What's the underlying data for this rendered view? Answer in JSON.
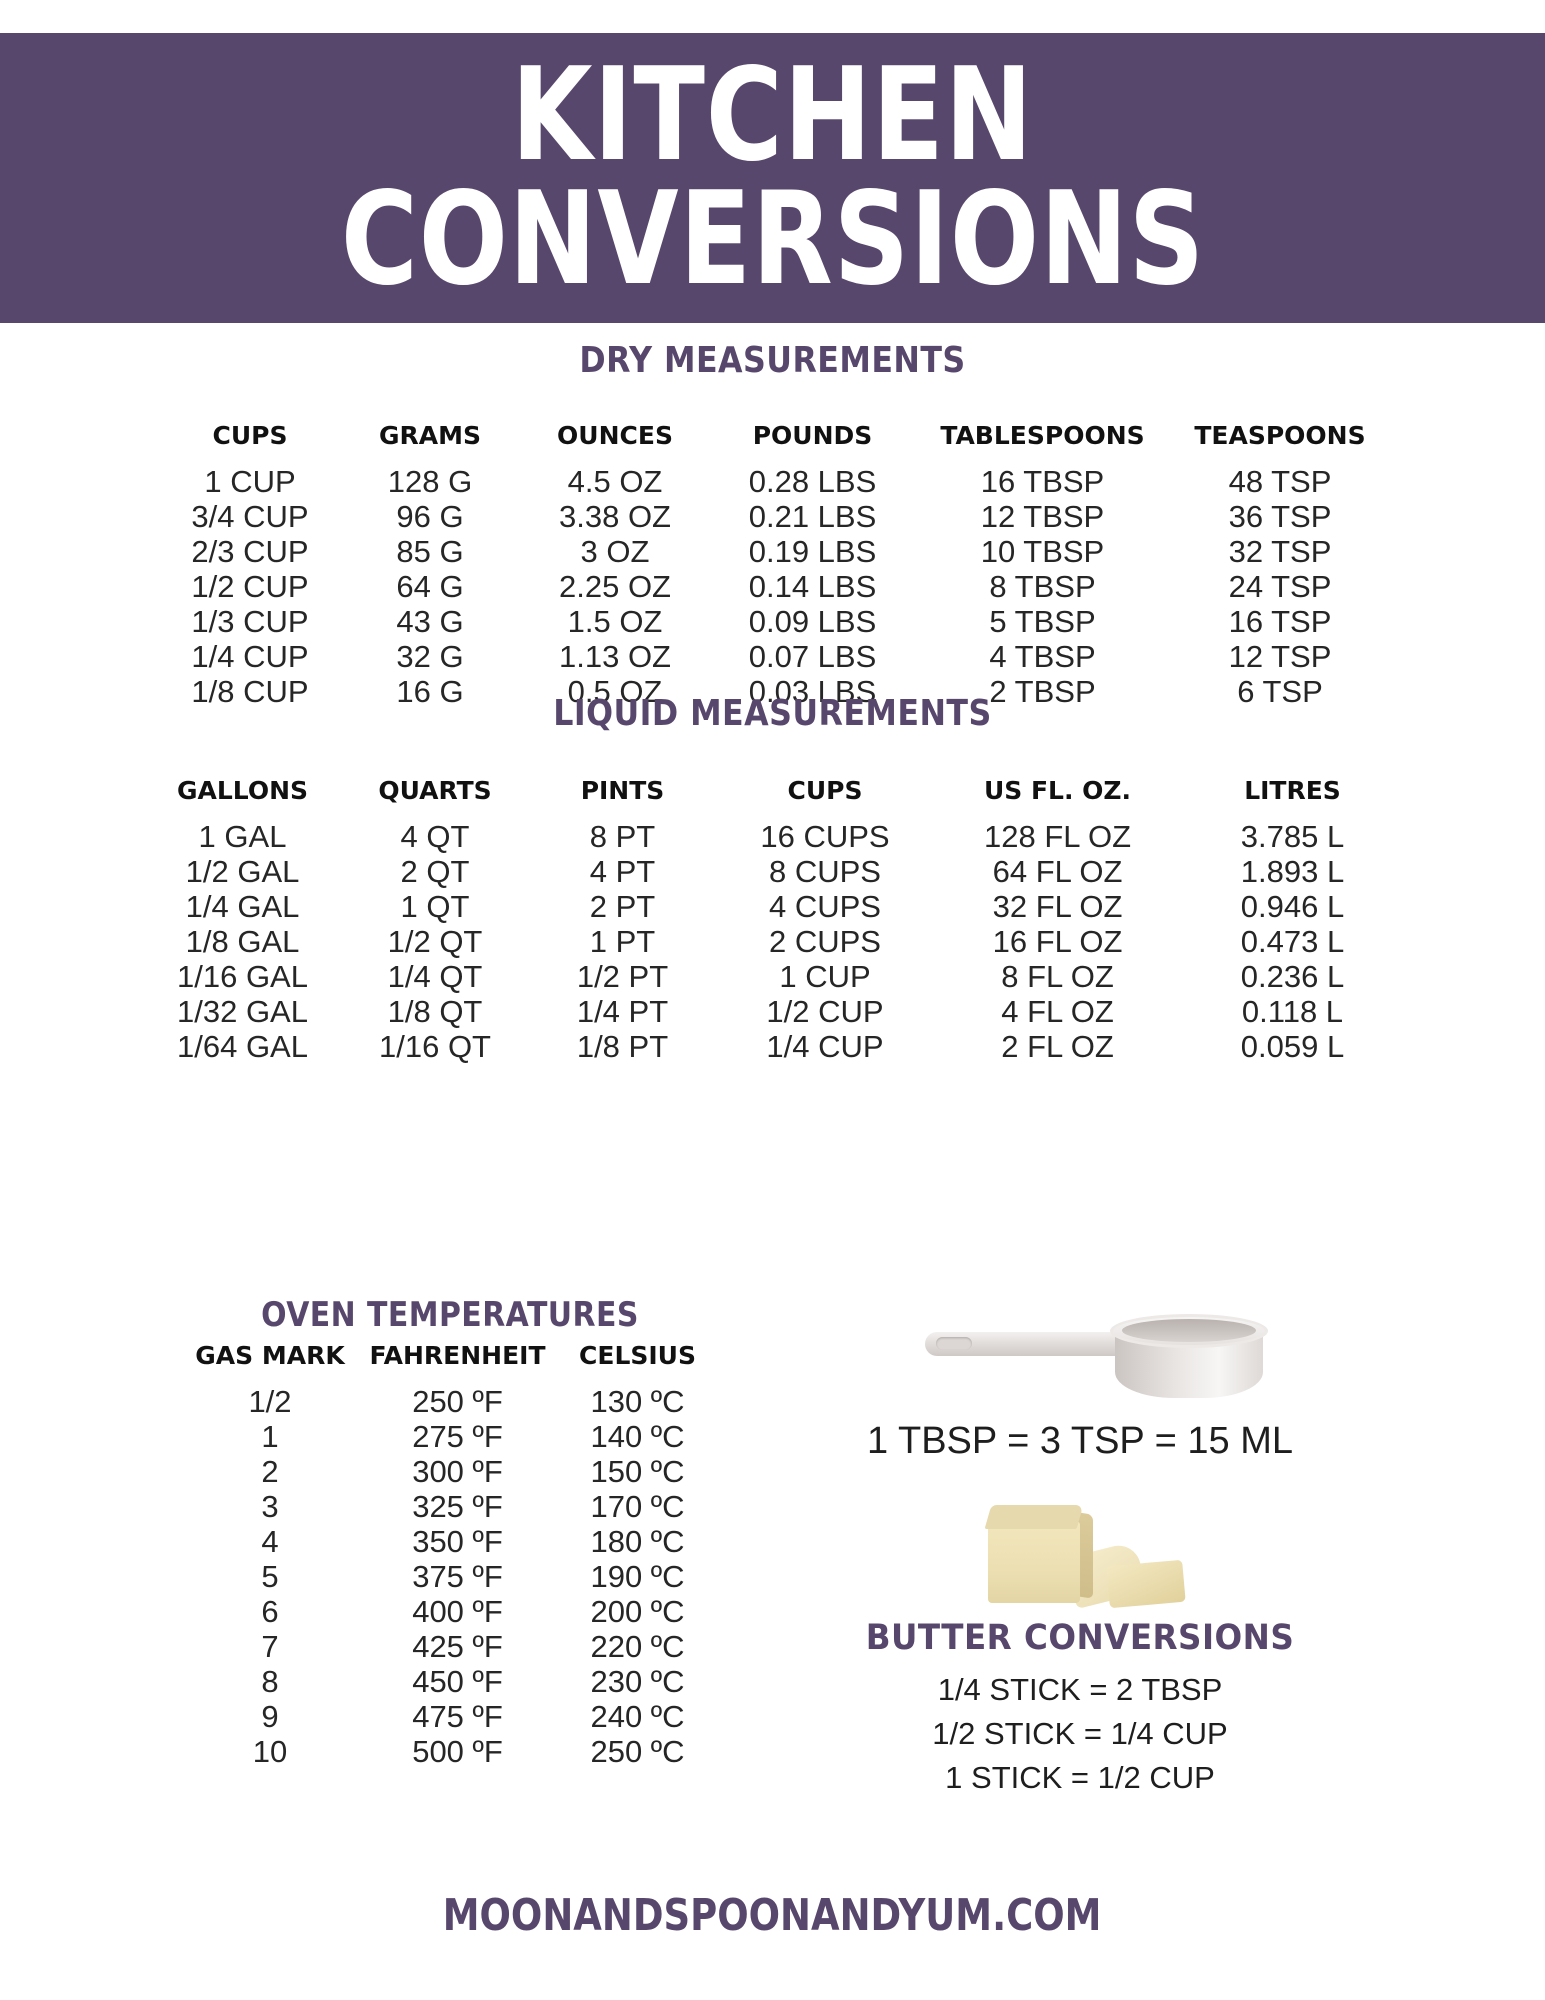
{
  "banner": {
    "line1": "KITCHEN",
    "line2": "CONVERSIONS",
    "background_color": "#58476C",
    "text_color": "#FFFFFF"
  },
  "accent_color": "#58476C",
  "dry": {
    "title": "DRY MEASUREMENTS",
    "columns": [
      "CUPS",
      "GRAMS",
      "OUNCES",
      "POUNDS",
      "TABLESPOONS",
      "TEASPOONS"
    ],
    "rows": [
      [
        "1 CUP",
        "128 G",
        "4.5 OZ",
        "0.28 LBS",
        "16 TBSP",
        "48 TSP"
      ],
      [
        "3/4 CUP",
        "96 G",
        "3.38 OZ",
        "0.21 LBS",
        "12 TBSP",
        "36 TSP"
      ],
      [
        "2/3 CUP",
        "85 G",
        "3 OZ",
        "0.19 LBS",
        "10 TBSP",
        "32 TSP"
      ],
      [
        "1/2 CUP",
        "64 G",
        "2.25 OZ",
        "0.14 LBS",
        "8 TBSP",
        "24 TSP"
      ],
      [
        "1/3 CUP",
        "43 G",
        "1.5 OZ",
        "0.09 LBS",
        "5 TBSP",
        "16 TSP"
      ],
      [
        "1/4 CUP",
        "32 G",
        "1.13 OZ",
        "0.07 LBS",
        "4 TBSP",
        "12 TSP"
      ],
      [
        "1/8 CUP",
        "16 G",
        "0.5 OZ",
        "0.03 LBS",
        "2 TBSP",
        "6 TSP"
      ]
    ]
  },
  "liquid": {
    "title": "LIQUID MEASUREMENTS",
    "columns": [
      "GALLONS",
      "QUARTS",
      "PINTS",
      "CUPS",
      "US FL. OZ.",
      "LITRES"
    ],
    "rows": [
      [
        "1 GAL",
        "4 QT",
        "8 PT",
        "16 CUPS",
        "128 FL OZ",
        "3.785 L"
      ],
      [
        "1/2 GAL",
        "2 QT",
        "4 PT",
        "8 CUPS",
        "64 FL OZ",
        "1.893 L"
      ],
      [
        "1/4 GAL",
        "1 QT",
        "2 PT",
        "4 CUPS",
        "32 FL OZ",
        "0.946 L"
      ],
      [
        "1/8 GAL",
        "1/2 QT",
        "1 PT",
        "2 CUPS",
        "16 FL OZ",
        "0.473 L"
      ],
      [
        "1/16 GAL",
        "1/4 QT",
        "1/2 PT",
        "1 CUP",
        "8 FL OZ",
        "0.236 L"
      ],
      [
        "1/32 GAL",
        "1/8 QT",
        "1/4 PT",
        "1/2 CUP",
        "4 FL OZ",
        "0.118 L"
      ],
      [
        "1/64 GAL",
        "1/16 QT",
        "1/8 PT",
        "1/4 CUP",
        "2 FL OZ",
        "0.059 L"
      ]
    ]
  },
  "oven": {
    "title": "OVEN TEMPERATURES",
    "columns": [
      "GAS MARK",
      "FAHRENHEIT",
      "CELSIUS"
    ],
    "rows": [
      [
        "1/2",
        "250 ºF",
        "130 ºC"
      ],
      [
        "1",
        "275 ºF",
        "140 ºC"
      ],
      [
        "2",
        "300 ºF",
        "150 ºC"
      ],
      [
        "3",
        "325 ºF",
        "170 ºC"
      ],
      [
        "4",
        "350 ºF",
        "180 ºC"
      ],
      [
        "5",
        "375 ºF",
        "190 ºC"
      ],
      [
        "6",
        "400 ºF",
        "200 ºC"
      ],
      [
        "7",
        "425 ºF",
        "220 ºC"
      ],
      [
        "8",
        "450 ºF",
        "230 ºC"
      ],
      [
        "9",
        "475 ºF",
        "240 ºC"
      ],
      [
        "10",
        "500 ºF",
        "250 ºC"
      ]
    ]
  },
  "spoon": {
    "icon": "measuring-spoon-icon",
    "equation": "1 TBSP = 3 TSP = 15 ML"
  },
  "butter": {
    "icon": "butter-blocks-icon",
    "title": "BUTTER  CONVERSIONS",
    "lines": [
      "1/4 STICK  = 2 TBSP",
      "1/2 STICK = 1/4 CUP",
      "1 STICK = 1/2 CUP"
    ]
  },
  "footer": {
    "url": "MOONANDSPOONANDYUM.COM"
  }
}
